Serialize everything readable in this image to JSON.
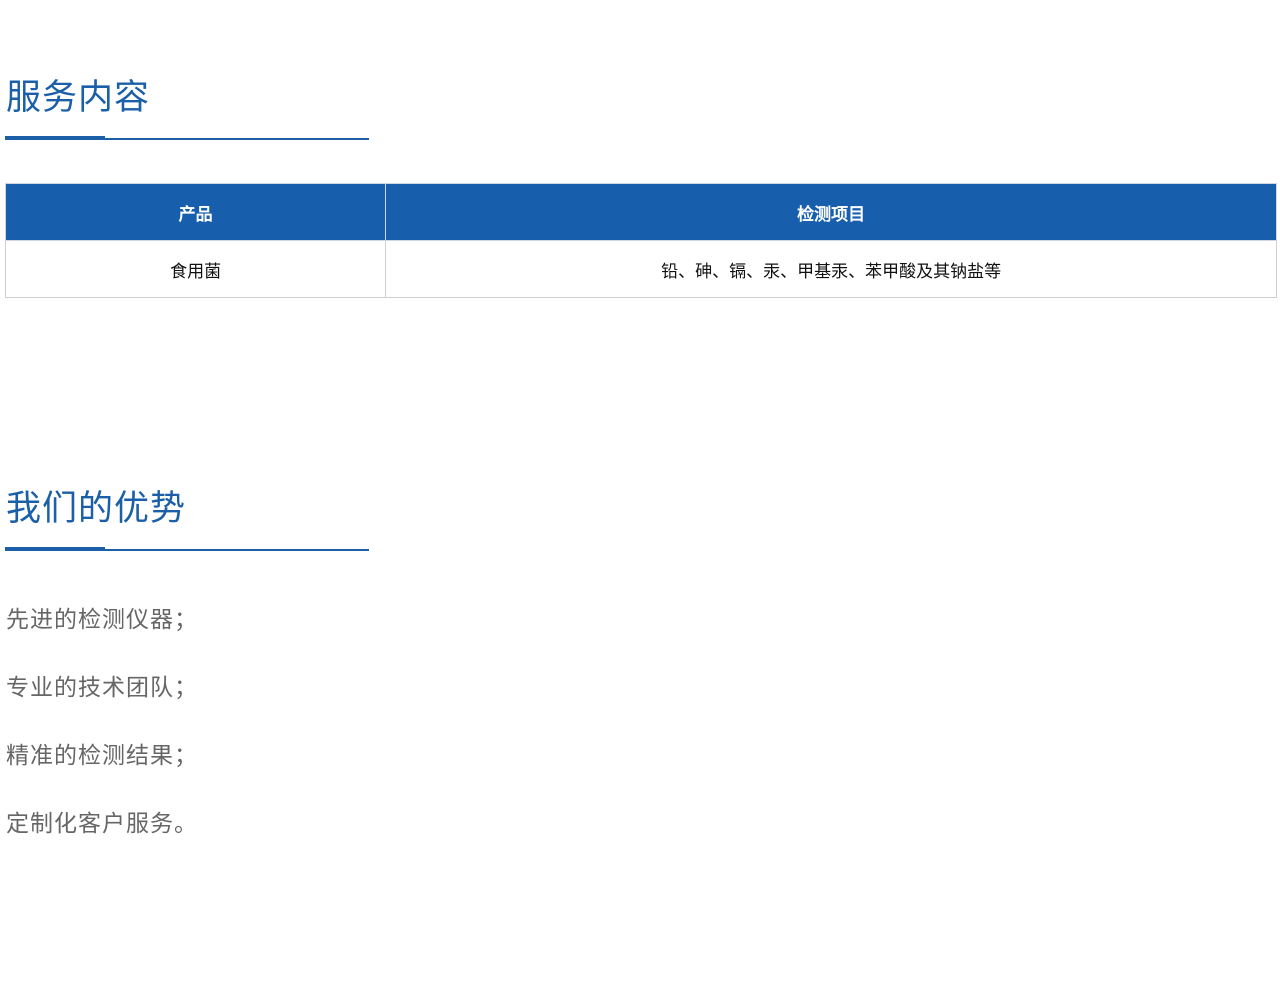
{
  "service": {
    "title": "服务内容",
    "table": {
      "headers": [
        "产品",
        "检测项目"
      ],
      "rows": [
        [
          "食用菌",
          "铅、砷、镉、汞、甲基汞、苯甲酸及其钠盐等"
        ]
      ]
    }
  },
  "advantages": {
    "title": "我们的优势",
    "items": [
      "先进的检测仪器；",
      "专业的技术团队；",
      "精准的检测结果；",
      "定制化客户服务。"
    ]
  },
  "colors": {
    "accent": "#1a5fa8",
    "header_bg": "#175fad",
    "body_text": "#666666"
  }
}
